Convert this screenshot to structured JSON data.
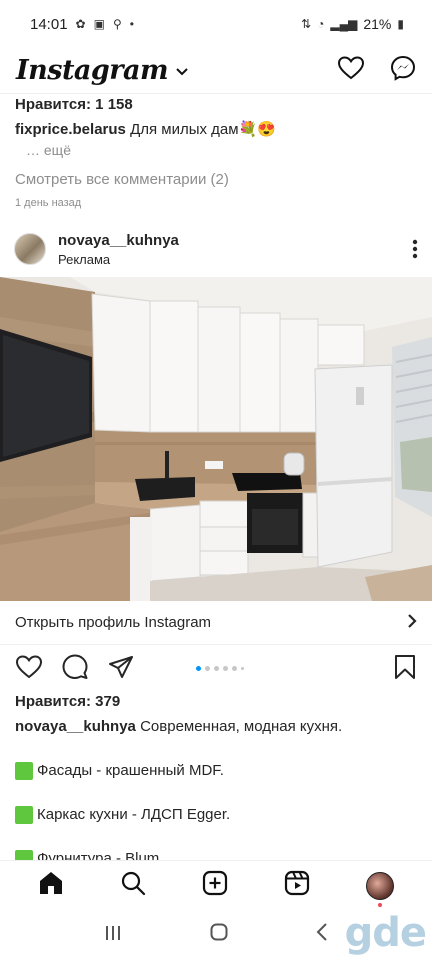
{
  "status_bar": {
    "time": "14:01",
    "battery": "21%"
  },
  "header": {
    "logo": "Instagram"
  },
  "previous_post": {
    "likes": "Нравится: 1 158",
    "caption_user": "fixprice.belarus",
    "caption_text": "Для милых дам💐😍",
    "more": "… ещё",
    "view_comments": "Смотреть все комментарии (2)",
    "time_ago": "1 день назад"
  },
  "post": {
    "username": "novaya__kuhnya",
    "sponsored": "Реклама",
    "cta": "Открыть профиль Instagram",
    "likes": "Нравится: 379",
    "caption_user": "novaya__kuhnya",
    "caption_text": "Современная, модная кухня.",
    "features": [
      "Фасады - крашенный MDF.",
      "Каркас кухни - ЛДСП Egger.",
      "Фурнитура - Blum."
    ],
    "carousel_count": 6,
    "carousel_active": 1
  },
  "colors": {
    "accent": "#0095f6",
    "notification": "#ed4956",
    "feature_square": "#5fc73d"
  },
  "watermark": "gde"
}
